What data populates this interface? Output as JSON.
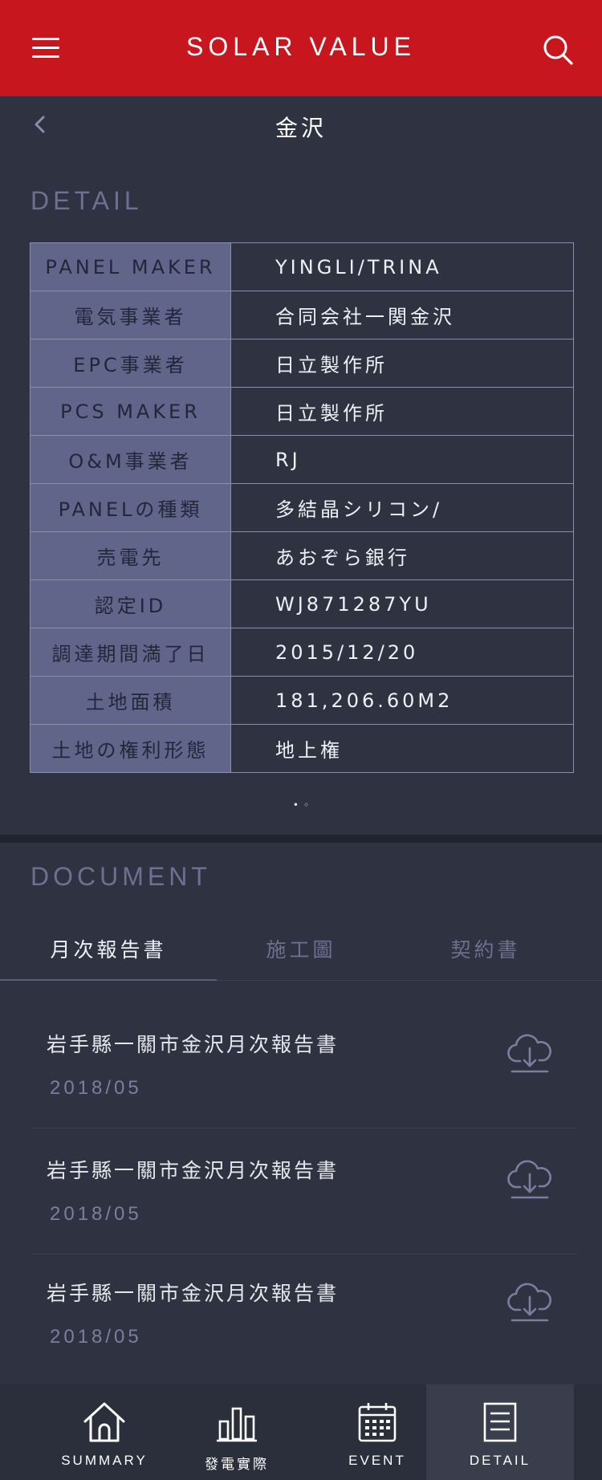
{
  "app": {
    "title": "SOLAR VALUE"
  },
  "subheader": {
    "place": "金沢"
  },
  "detail": {
    "section_title": "DETAIL",
    "rows": [
      {
        "label": "PANEL MAKER",
        "value": "YINGLI/TRINA"
      },
      {
        "label": "電気事業者",
        "value": "合同会社一関金沢"
      },
      {
        "label": "EPC事業者",
        "value": "日立製作所"
      },
      {
        "label": "PCS MAKER",
        "value": "日立製作所"
      },
      {
        "label": "O&M事業者",
        "value": "RJ"
      },
      {
        "label": "PANELの種類",
        "value": "多結晶シリコン/"
      },
      {
        "label": "売電先",
        "value": "あおぞら銀行"
      },
      {
        "label": "認定ID",
        "value": "WJ871287YU"
      },
      {
        "label": "調達期間満了日",
        "value": "2015/12/20"
      },
      {
        "label": "土地面積",
        "value": "181,206.60M2"
      },
      {
        "label": "土地の権利形態",
        "value": "地上権"
      }
    ],
    "pager": {
      "active": "•",
      "inactive": "◦"
    }
  },
  "document": {
    "section_title": "DOCUMENT",
    "tabs": [
      {
        "label": "月次報告書"
      },
      {
        "label": "施工圖"
      },
      {
        "label": "契約書"
      }
    ],
    "items": [
      {
        "title": "岩手縣一關市金沢月次報告書",
        "date": "2018/05"
      },
      {
        "title": "岩手縣一關市金沢月次報告書",
        "date": "2018/05"
      },
      {
        "title": "岩手縣一關市金沢月次報告書",
        "date": "2018/05"
      }
    ]
  },
  "bottom_nav": {
    "summary": "SUMMARY",
    "actual": "發電實際",
    "event": "EVENT",
    "detail": "DETAIL"
  },
  "colors": {
    "brand_red": "#c8161f",
    "background": "#2f3240",
    "label_cell": "#61658a",
    "muted_text": "#6d7191"
  },
  "icons": [
    "menu-icon",
    "search-icon",
    "back-chevron-icon",
    "cloud-download-icon",
    "home-icon",
    "bar-chart-icon",
    "calendar-icon",
    "document-icon"
  ]
}
